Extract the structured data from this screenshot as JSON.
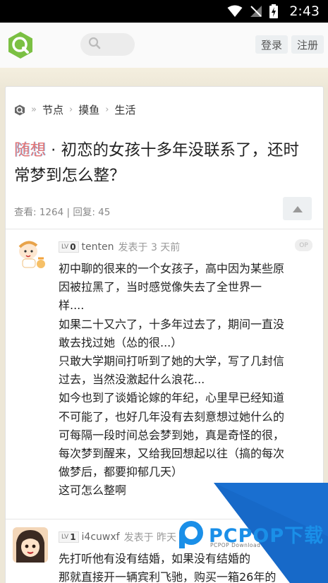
{
  "status_bar": {
    "time": "2:43",
    "icons": [
      "wifi-icon",
      "no-signal-icon",
      "battery-charging-icon"
    ]
  },
  "header": {
    "logo": "v2ex-style-logo",
    "search_icon": "search-icon",
    "login_label": "登录",
    "register_label": "注册"
  },
  "breadcrumb": {
    "home_icon": "home-logo-icon",
    "items": [
      "节点",
      "摸鱼",
      "生活"
    ]
  },
  "topic": {
    "keyword": "随想",
    "title_rest": "· 初恋的女孩十多年没联系了，还时常梦到怎么整？",
    "views": "查看: 1264",
    "sep": " | ",
    "replies": "回复: 45",
    "upvote_icon": "upvote-triangle-icon"
  },
  "replies": [
    {
      "level_prefix": "LV",
      "level": "0",
      "username": "tenten",
      "posted": "发表于 3 天前",
      "op_badge": "OP",
      "lines": [
        "初中聊的很来的一个女孩子，高中因为某些原",
        "因被拉黑了，当时感觉像失去了全世界一",
        "样....",
        "如果二十又六了，十多年过去了，期间一直没",
        "敢去找过她（怂的很...）",
        "只敢大学期间打听到了她的大学，写了几封信",
        "过去，当然没激起什么浪花...",
        "如今也到了谈婚论嫁的年纪，心里早已经知道",
        "不可能了，也好几年没有去刻意想过她什么的",
        "可每隔一段时间总会梦到她，真是奇怪的很，",
        "每次梦到醒来，又给我回想起以往（搞的每次",
        "做梦后，都要抑郁几天）",
        "这可怎么整啊"
      ]
    },
    {
      "level_prefix": "LV",
      "level": "1",
      "username": "i4cuwxf",
      "posted": "发表于 昨天",
      "lines": [
        "先打听他有没有结婚，如果没有结婚的",
        "那就直接开一辆宾利飞驰，购买一箱26年的"
      ]
    }
  ],
  "watermark": {
    "text": "PCPOP下载",
    "sub": "PCPOP Download"
  }
}
